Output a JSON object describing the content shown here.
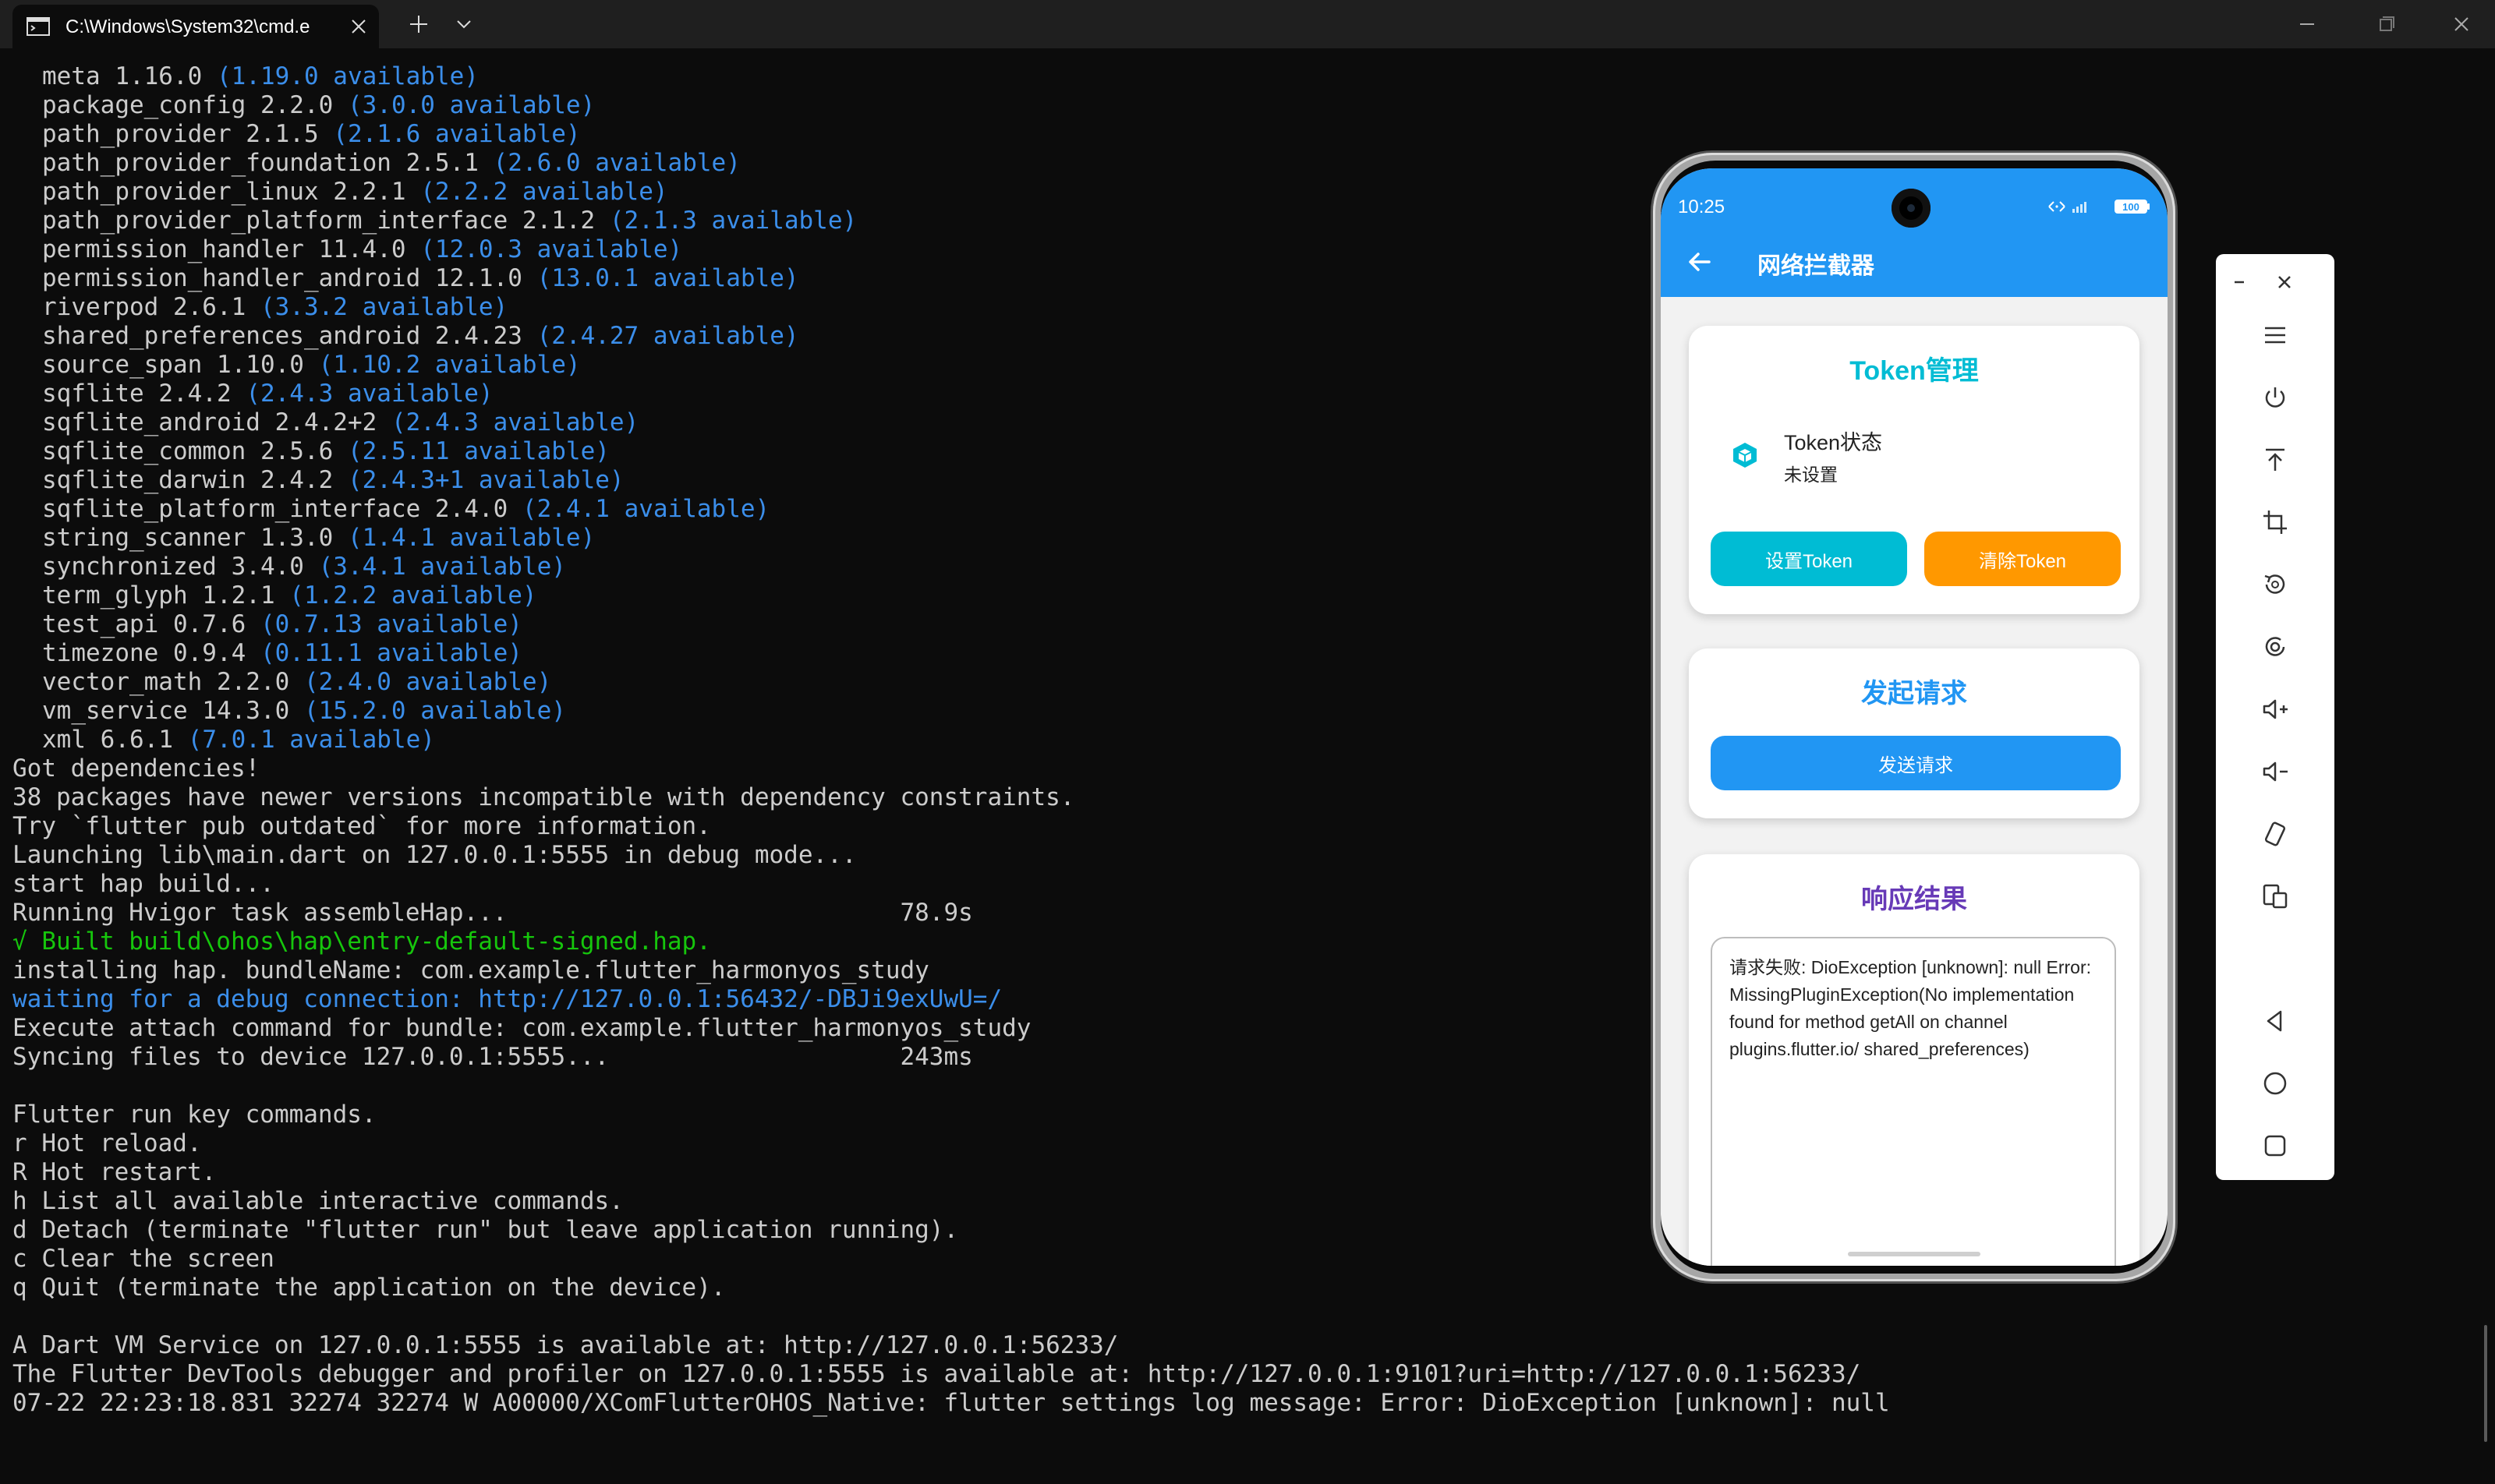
{
  "window": {
    "tab_title": "C:\\Windows\\System32\\cmd.e"
  },
  "terminal": {
    "packages": [
      {
        "name": "meta",
        "version": "1.16.0",
        "available": "(1.19.0 available)"
      },
      {
        "name": "package_config",
        "version": "2.2.0",
        "available": "(3.0.0 available)"
      },
      {
        "name": "path_provider",
        "version": "2.1.5",
        "available": "(2.1.6 available)"
      },
      {
        "name": "path_provider_foundation",
        "version": "2.5.1",
        "available": "(2.6.0 available)"
      },
      {
        "name": "path_provider_linux",
        "version": "2.2.1",
        "available": "(2.2.2 available)"
      },
      {
        "name": "path_provider_platform_interface",
        "version": "2.1.2",
        "available": "(2.1.3 available)"
      },
      {
        "name": "permission_handler",
        "version": "11.4.0",
        "available": "(12.0.3 available)"
      },
      {
        "name": "permission_handler_android",
        "version": "12.1.0",
        "available": "(13.0.1 available)"
      },
      {
        "name": "riverpod",
        "version": "2.6.1",
        "available": "(3.3.2 available)"
      },
      {
        "name": "shared_preferences_android",
        "version": "2.4.23",
        "available": "(2.4.27 available)"
      },
      {
        "name": "source_span",
        "version": "1.10.0",
        "available": "(1.10.2 available)"
      },
      {
        "name": "sqflite",
        "version": "2.4.2",
        "available": "(2.4.3 available)"
      },
      {
        "name": "sqflite_android",
        "version": "2.4.2+2",
        "available": "(2.4.3 available)"
      },
      {
        "name": "sqflite_common",
        "version": "2.5.6",
        "available": "(2.5.11 available)"
      },
      {
        "name": "sqflite_darwin",
        "version": "2.4.2",
        "available": "(2.4.3+1 available)"
      },
      {
        "name": "sqflite_platform_interface",
        "version": "2.4.0",
        "available": "(2.4.1 available)"
      },
      {
        "name": "string_scanner",
        "version": "1.3.0",
        "available": "(1.4.1 available)"
      },
      {
        "name": "synchronized",
        "version": "3.4.0",
        "available": "(3.4.1 available)"
      },
      {
        "name": "term_glyph",
        "version": "1.2.1",
        "available": "(1.2.2 available)"
      },
      {
        "name": "test_api",
        "version": "0.7.6",
        "available": "(0.7.13 available)"
      },
      {
        "name": "timezone",
        "version": "0.9.4",
        "available": "(0.11.1 available)"
      },
      {
        "name": "vector_math",
        "version": "2.2.0",
        "available": "(2.4.0 available)"
      },
      {
        "name": "vm_service",
        "version": "14.3.0",
        "available": "(15.2.0 available)"
      },
      {
        "name": "xml",
        "version": "6.6.1",
        "available": "(7.0.1 available)"
      }
    ],
    "lines": [
      {
        "text": "Got dependencies!",
        "style": "plain"
      },
      {
        "text": "38 packages have newer versions incompatible with dependency constraints.",
        "style": "plain"
      },
      {
        "text": "Try `flutter pub outdated` for more information.",
        "style": "plain"
      },
      {
        "text": "Launching lib\\main.dart on 127.0.0.1:5555 in debug mode...",
        "style": "plain"
      },
      {
        "text": "start hap build...",
        "style": "plain"
      },
      {
        "text": "Running Hvigor task assembleHap...                           78.9s",
        "style": "plain"
      },
      {
        "text": "√ Built build\\ohos\\hap\\entry-default-signed.hap.",
        "style": "green"
      },
      {
        "text": "installing hap. bundleName: com.example.flutter_harmonyos_study",
        "style": "plain"
      },
      {
        "text": "waiting for a debug connection: http://127.0.0.1:56432/-DBJi9exUwU=/",
        "style": "blue"
      },
      {
        "text": "Execute attach command for bundle: com.example.flutter_harmonyos_study",
        "style": "plain"
      },
      {
        "text": "Syncing files to device 127.0.0.1:5555...                    243ms",
        "style": "plain"
      },
      {
        "text": "",
        "style": "plain"
      },
      {
        "text": "Flutter run key commands.",
        "style": "plain"
      },
      {
        "text": "r Hot reload.",
        "style": "plain"
      },
      {
        "text": "R Hot restart.",
        "style": "plain"
      },
      {
        "text": "h List all available interactive commands.",
        "style": "plain"
      },
      {
        "text": "d Detach (terminate \"flutter run\" but leave application running).",
        "style": "plain"
      },
      {
        "text": "c Clear the screen",
        "style": "plain"
      },
      {
        "text": "q Quit (terminate the application on the device).",
        "style": "plain"
      },
      {
        "text": "",
        "style": "plain"
      },
      {
        "text": "A Dart VM Service on 127.0.0.1:5555 is available at: http://127.0.0.1:56233/",
        "style": "plain"
      },
      {
        "text": "The Flutter DevTools debugger and profiler on 127.0.0.1:5555 is available at: http://127.0.0.1:9101?uri=http://127.0.0.1:56233/",
        "style": "plain"
      },
      {
        "text": "07-22 22:23:18.831 32274 32274 W A00000/XComFlutterOHOS_Native: flutter settings log message: Error: DioException [unknown]: null",
        "style": "plain"
      }
    ],
    "colors": {
      "text": "#cccccc",
      "blue": "#3b8eea",
      "green": "#16c60c",
      "background": "#0c0c0c"
    }
  },
  "phone": {
    "status_time": "10:25",
    "battery": "100",
    "app_title": "网络拦截器",
    "token_card": {
      "title": "Token管理",
      "status_label": "Token状态",
      "status_value": "未设置",
      "set_button": "设置Token",
      "clear_button": "清除Token"
    },
    "request_card": {
      "title": "发起请求",
      "send_button": "发送请求"
    },
    "response_card": {
      "title": "响应结果",
      "content": "请求失败: DioException [unknown]: null Error: MissingPluginException(No implementation found for method getAll on channel plugins.flutter.io/ shared_preferences)"
    },
    "colors": {
      "appbar": "#2196f3",
      "token_accent": "#00bcd4",
      "clear_button": "#ff9800",
      "response_title": "#673ab7"
    }
  },
  "side_toolbar": {
    "icons": [
      "menu-icon",
      "power-icon",
      "upload-icon",
      "crop-icon",
      "rotate-icon",
      "screenshot-icon",
      "volume-up-icon",
      "volume-down-icon",
      "shake-icon",
      "multi-device-icon",
      "back-icon",
      "home-icon",
      "recents-icon"
    ]
  }
}
